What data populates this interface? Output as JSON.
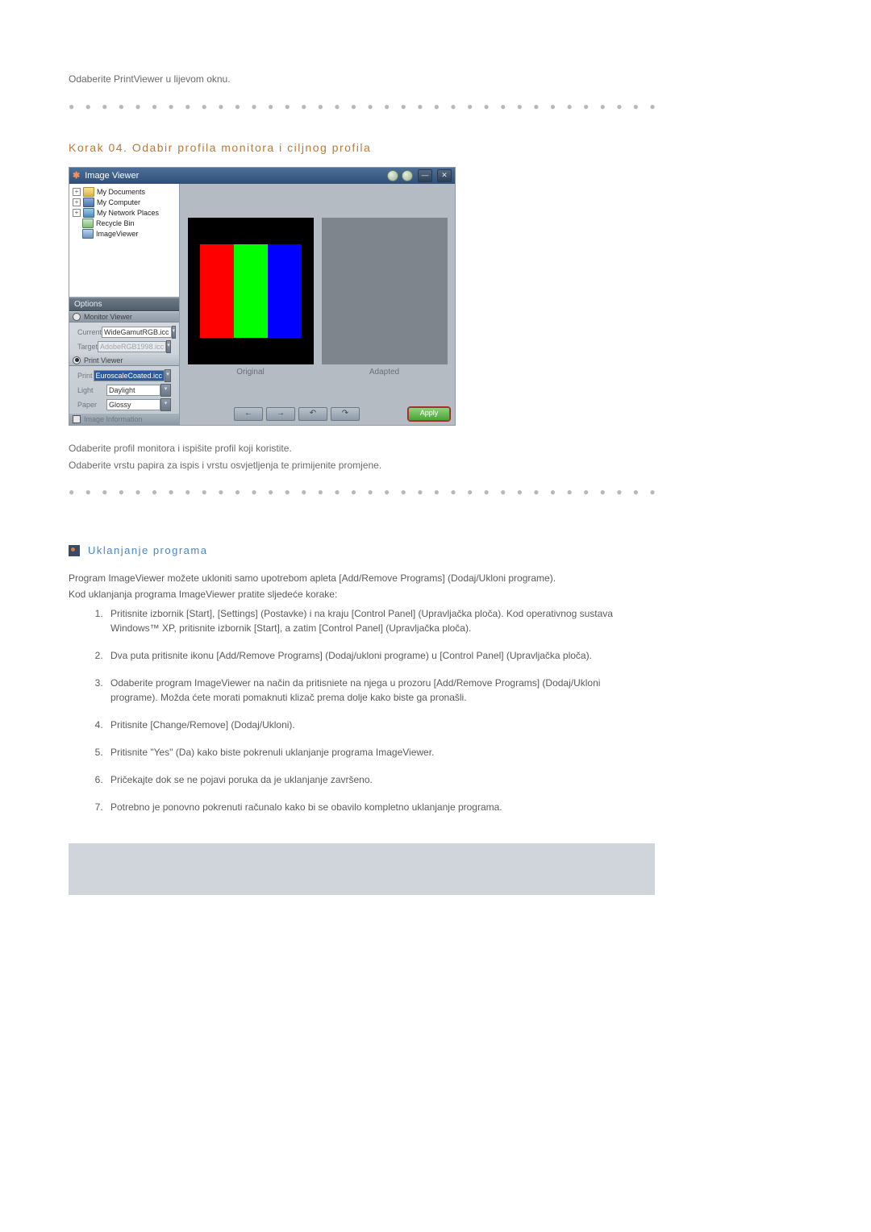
{
  "intro_text": "Odaberite PrintViewer u lijevom oknu.",
  "dot_separator": "● ● ● ● ● ● ● ● ● ● ● ● ● ● ● ● ● ● ● ● ● ● ● ● ● ● ● ● ● ● ● ● ● ● ● ● ● ● ● ● ● ● ● ● ● ● ●",
  "step_heading": "Korak 04. Odabir profila monitora i ciljnog profila",
  "iv": {
    "title": "Image Viewer",
    "min_btn": "—",
    "close_btn": "✕",
    "tree": {
      "my_documents": "My Documents",
      "my_computer": "My Computer",
      "my_network": "My Network Places",
      "recycle_bin": "Recycle Bin",
      "image_viewer": "ImageViewer"
    },
    "options_header": "Options",
    "monitor_viewer": "Monitor Viewer",
    "current_label": "Current",
    "current_value": "WideGamutRGB.icc",
    "target_label": "Target",
    "target_value": "AdobeRGB1998.icc",
    "print_viewer": "Print Viewer",
    "print_label": "Print",
    "print_value": "EuroscaleCoated.icc",
    "light_label": "Light",
    "light_value": "Daylight",
    "paper_label": "Paper",
    "paper_value": "Glossy",
    "image_information": "Image Information",
    "original_label": "Original",
    "adapted_label": "Adapted",
    "prev_btn": "←",
    "next_btn": "→",
    "rot_l_btn": "↶",
    "rot_r_btn": "↷",
    "apply_btn": "Apply"
  },
  "after_iv_line1": "Odaberite profil monitora i ispišite profil koji koristite.",
  "after_iv_line2": "Odaberite vrstu papira za ispis i vrstu osvjetljenja te primijenite promjene.",
  "uninstall": {
    "title": "Uklanjanje programa",
    "p1": "Program ImageViewer možete ukloniti samo upotrebom apleta [Add/Remove Programs] (Dodaj/Ukloni programe).",
    "p2": "Kod uklanjanja programa ImageViewer pratite sljedeće korake:",
    "steps": [
      "Pritisnite izbornik [Start], [Settings] (Postavke) i na kraju [Control Panel] (Upravljačka ploča). Kod operativnog sustava Windows™ XP, pritisnite izbornik [Start], a zatim [Control Panel] (Upravljačka ploča).",
      "Dva puta pritisnite ikonu [Add/Remove Programs] (Dodaj/ukloni programe) u [Control Panel] (Upravljačka ploča).",
      "Odaberite program ImageViewer na način da pritisniete na njega u prozoru [Add/Remove Programs] (Dodaj/Ukloni programe). Možda ćete morati pomaknuti klizač prema dolje kako biste ga pronašli.",
      "Pritisnite [Change/Remove] (Dodaj/Ukloni).",
      "Pritisnite \"Yes\" (Da) kako biste pokrenuli uklanjanje programa ImageViewer.",
      "Pričekajte dok se ne pojavi poruka da je uklanjanje završeno.",
      "Potrebno je ponovno pokrenuti računalo kako bi se obavilo kompletno uklanjanje programa."
    ]
  }
}
